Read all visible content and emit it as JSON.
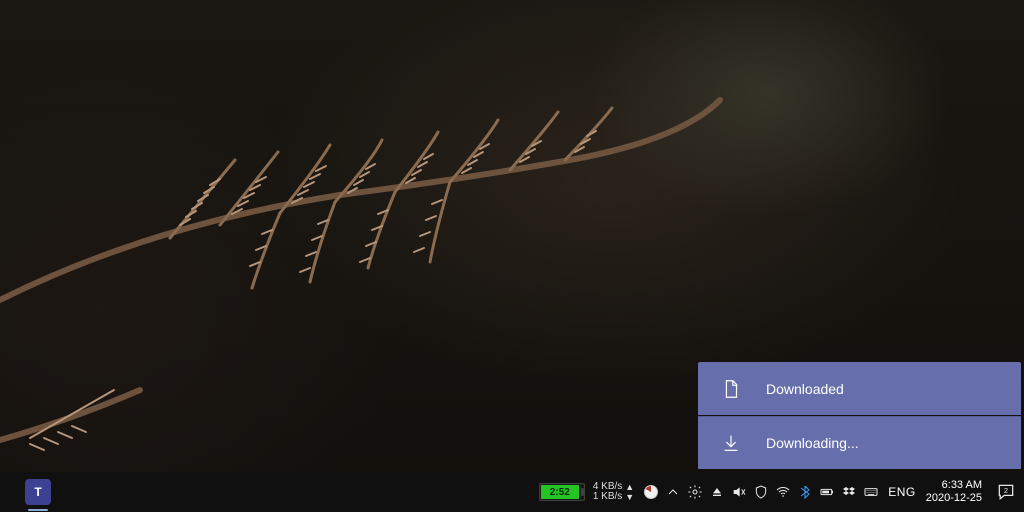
{
  "toasts": [
    {
      "icon": "file-icon",
      "label": "Downloaded"
    },
    {
      "icon": "download-icon",
      "label": "Downloading..."
    }
  ],
  "taskbar": {
    "apps": [
      {
        "name": "microsoft-teams",
        "letter": "T"
      }
    ],
    "battery": {
      "text": "2:52",
      "color": "#24c424"
    },
    "netspeed": {
      "up": "4 KB/s",
      "down": "1 KB/s"
    },
    "language": "ENG",
    "clock": {
      "time": "6:33 AM",
      "date": "2020-12-25"
    },
    "notification_badge": "2",
    "tray_icons": [
      "chevron-up-icon",
      "settings-icon",
      "eject-icon",
      "volume-mute-icon",
      "security-icon",
      "wifi-icon",
      "bluetooth-icon",
      "power-icon",
      "dropbox-icon",
      "keyboard-icon"
    ]
  }
}
